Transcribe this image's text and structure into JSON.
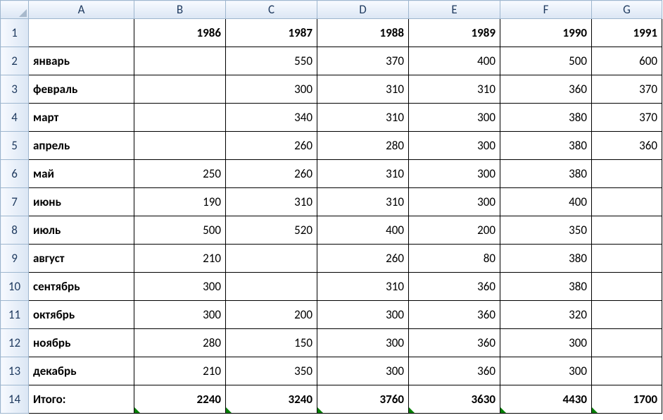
{
  "columns": [
    "A",
    "B",
    "C",
    "D",
    "E",
    "F",
    "G"
  ],
  "rowCount": 14,
  "headerRow": {
    "A": "",
    "B": "1986",
    "C": "1987",
    "D": "1988",
    "E": "1989",
    "F": "1990",
    "G": "1991"
  },
  "rows": [
    {
      "label": "январь",
      "B": "",
      "C": "550",
      "D": "370",
      "E": "400",
      "F": "500",
      "G": "600"
    },
    {
      "label": "февраль",
      "B": "",
      "C": "300",
      "D": "310",
      "E": "310",
      "F": "360",
      "G": "370"
    },
    {
      "label": "март",
      "B": "",
      "C": "340",
      "D": "310",
      "E": "300",
      "F": "380",
      "G": "370"
    },
    {
      "label": "апрель",
      "B": "",
      "C": "260",
      "D": "280",
      "E": "300",
      "F": "380",
      "G": "360"
    },
    {
      "label": "май",
      "B": "250",
      "C": "260",
      "D": "310",
      "E": "300",
      "F": "380",
      "G": ""
    },
    {
      "label": "июнь",
      "B": "190",
      "C": "310",
      "D": "310",
      "E": "300",
      "F": "400",
      "G": ""
    },
    {
      "label": "июль",
      "B": "500",
      "C": "520",
      "D": "400",
      "E": "200",
      "F": "350",
      "G": ""
    },
    {
      "label": "август",
      "B": "210",
      "C": "",
      "D": "260",
      "E": "80",
      "F": "380",
      "G": ""
    },
    {
      "label": "сентябрь",
      "B": "300",
      "C": "",
      "D": "310",
      "E": "360",
      "F": "380",
      "G": ""
    },
    {
      "label": "октябрь",
      "B": "300",
      "C": "200",
      "D": "300",
      "E": "360",
      "F": "320",
      "G": ""
    },
    {
      "label": "ноябрь",
      "B": "280",
      "C": "150",
      "D": "300",
      "E": "360",
      "F": "300",
      "G": ""
    },
    {
      "label": "декабрь",
      "B": "210",
      "C": "350",
      "D": "300",
      "E": "360",
      "F": "300",
      "G": ""
    }
  ],
  "totalRow": {
    "label": "Итого:",
    "B": "2240",
    "C": "3240",
    "D": "3760",
    "E": "3630",
    "F": "4430",
    "G": "1700"
  },
  "chart_data": {
    "type": "table",
    "title": "",
    "columns": [
      "1986",
      "1987",
      "1988",
      "1989",
      "1990",
      "1991"
    ],
    "rows": [
      "январь",
      "февраль",
      "март",
      "апрель",
      "май",
      "июнь",
      "июль",
      "август",
      "сентябрь",
      "октябрь",
      "ноябрь",
      "декабрь"
    ],
    "data": [
      [
        null,
        550,
        370,
        400,
        500,
        600
      ],
      [
        null,
        300,
        310,
        310,
        360,
        370
      ],
      [
        null,
        340,
        310,
        300,
        380,
        370
      ],
      [
        null,
        260,
        280,
        300,
        380,
        360
      ],
      [
        250,
        260,
        310,
        300,
        380,
        null
      ],
      [
        190,
        310,
        310,
        300,
        400,
        null
      ],
      [
        500,
        520,
        400,
        200,
        350,
        null
      ],
      [
        210,
        null,
        260,
        80,
        380,
        null
      ],
      [
        300,
        null,
        310,
        360,
        380,
        null
      ],
      [
        300,
        200,
        300,
        360,
        320,
        null
      ],
      [
        280,
        150,
        300,
        360,
        300,
        null
      ],
      [
        210,
        350,
        300,
        360,
        300,
        null
      ]
    ],
    "totals": {
      "1986": 2240,
      "1987": 3240,
      "1988": 3760,
      "1989": 3630,
      "1990": 4430,
      "1991": 1700
    }
  }
}
